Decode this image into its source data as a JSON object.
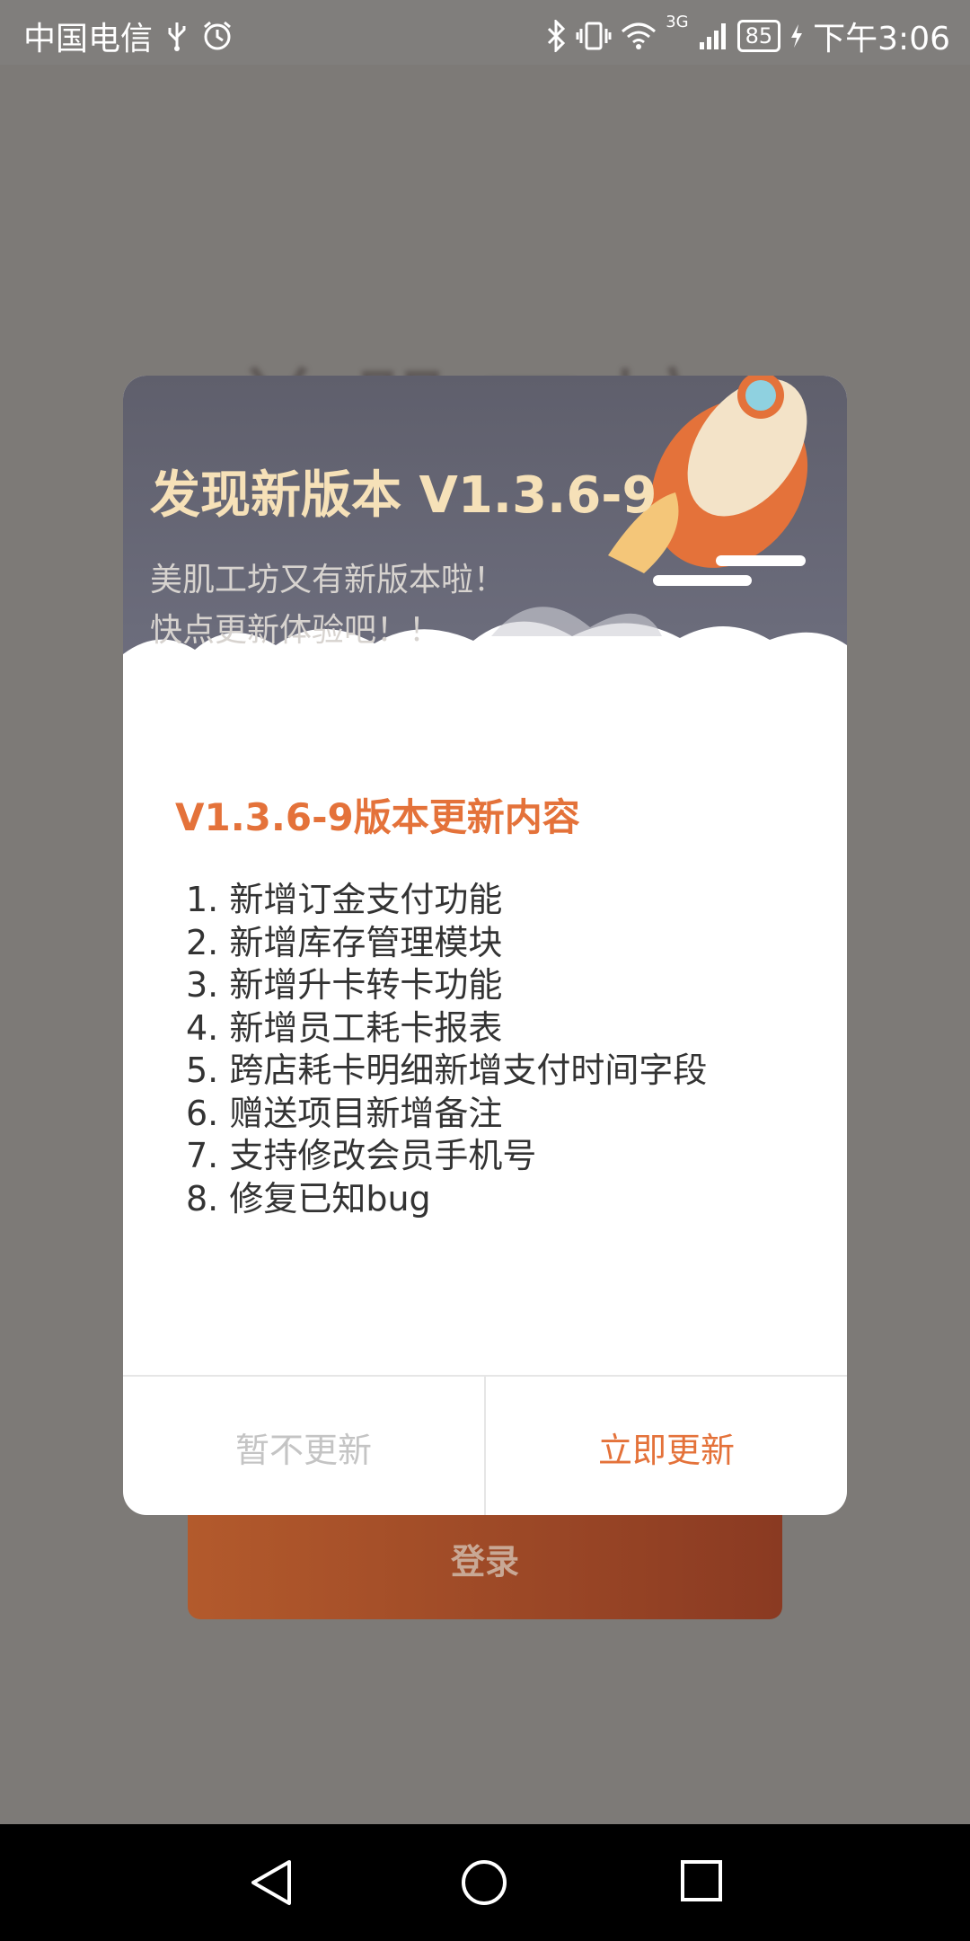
{
  "status_bar": {
    "carrier": "中国电信",
    "network_label": "3G",
    "battery": "85",
    "time": "下午3:06"
  },
  "background": {
    "app_title": "美肌工坊",
    "login_button": "登录"
  },
  "dialog": {
    "title": "发现新版本 V1.3.6-9",
    "subtitle_line1": "美肌工坊又有新版本啦！",
    "subtitle_line2": "快点更新体验吧！！",
    "section_title": "V1.3.6-9版本更新内容",
    "notes": [
      "1. 新增订金支付功能",
      "2. 新增库存管理模块",
      "3. 新增升卡转卡功能",
      "4. 新增员工耗卡报表",
      "5. 跨店耗卡明细新增支付时间字段",
      "6. 赠送项目新增备注",
      "7. 支持修改会员手机号",
      "8. 修复已知bug"
    ],
    "later_button": "暂不更新",
    "update_button": "立即更新"
  },
  "colors": {
    "accent": "#e4723a",
    "header_bg": "#636372",
    "title_gold": "#f6e1b8"
  }
}
